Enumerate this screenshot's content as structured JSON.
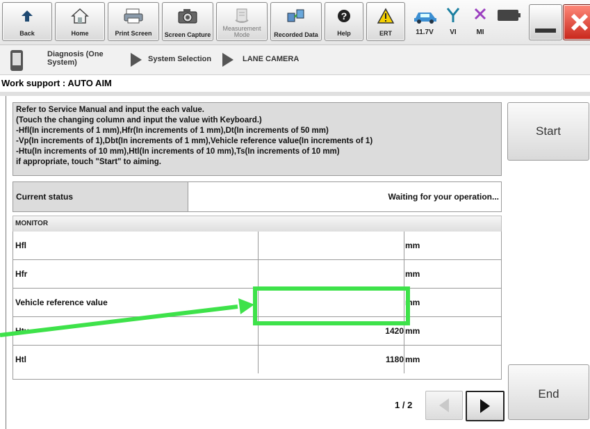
{
  "toolbar": {
    "buttons": [
      {
        "label": "Back",
        "icon": "back-arrow-icon"
      },
      {
        "label": "Home",
        "icon": "home-icon"
      },
      {
        "label": "Print Screen",
        "icon": "printer-icon"
      },
      {
        "label": "Screen Capture",
        "icon": "camera-icon"
      },
      {
        "label": "Measurement Mode",
        "icon": "measurement-icon"
      },
      {
        "label": "Recorded Data",
        "icon": "recorded-data-icon"
      },
      {
        "label": "Help",
        "icon": "help-icon"
      },
      {
        "label": "ERT",
        "icon": "warning-icon"
      }
    ],
    "status": {
      "voltage": "11.7V",
      "vi": "VI",
      "mi": "MI"
    }
  },
  "breadcrumb": {
    "step1": "Diagnosis (One System)",
    "step2": "System Selection",
    "step3": "LANE CAMERA"
  },
  "page_title": "Work support : AUTO AIM",
  "instructions": [
    "Refer to Service Manual and input the each value.",
    "(Touch the changing column and input the value with Keyboard.)",
    "-Hfl(In increments of 1 mm),Hfr(In increments of 1 mm),Dt(In increments of 50 mm)",
    "-Vp(In increments of 1),Dbt(In increments of 1 mm),Vehicle reference value(In increments of 1)",
    "-Htu(In increments of 10 mm),Htl(In increments of 10 mm),Ts(In increments of 10 mm)",
    "if appropriate, touch \"Start\" to aiming."
  ],
  "start_label": "Start",
  "end_label": "End",
  "current_status": {
    "label": "Current status",
    "value": "Waiting for your operation..."
  },
  "monitor_header": "MONITOR",
  "monitor_rows": [
    {
      "name": "Hfl",
      "value": "",
      "unit": "mm"
    },
    {
      "name": "Hfr",
      "value": "",
      "unit": "mm"
    },
    {
      "name": "Vehicle reference value",
      "value": "",
      "unit": "mm"
    },
    {
      "name": "Htu",
      "value": "1420",
      "unit": "mm"
    },
    {
      "name": "Htl",
      "value": "1180",
      "unit": "mm"
    }
  ],
  "pager": "1 / 2",
  "highlight_color": "#3ee24a"
}
